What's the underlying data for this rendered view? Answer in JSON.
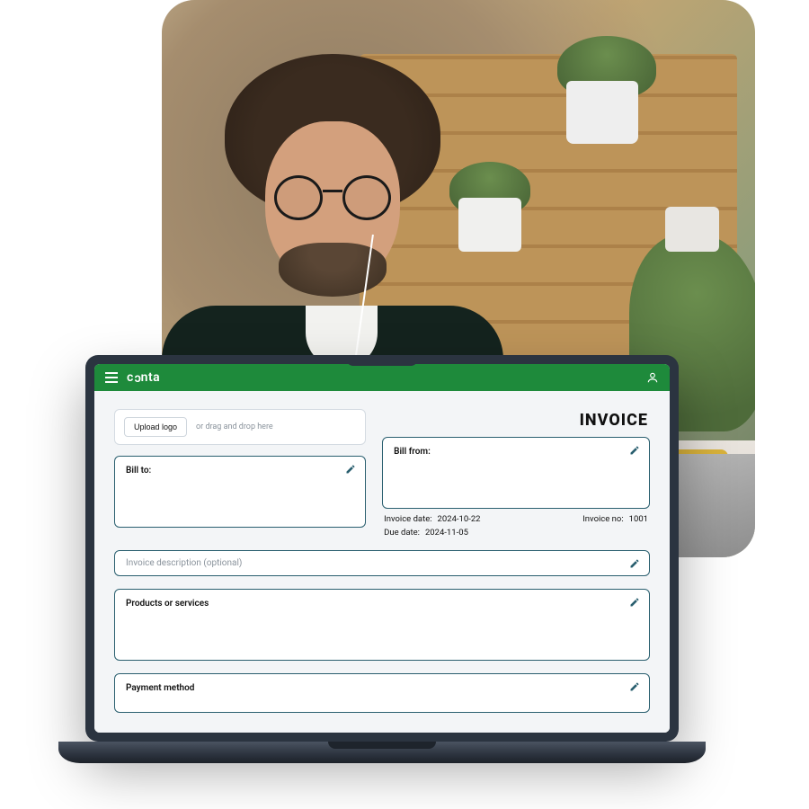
{
  "brand": {
    "name": "conta"
  },
  "header": {
    "menu_icon": "menu-icon",
    "user_icon": "user-icon"
  },
  "invoice": {
    "title": "INVOICE",
    "upload_button": "Upload logo",
    "upload_hint": "or drag and drop here",
    "bill_to_label": "Bill to:",
    "bill_from_label": "Bill from:",
    "invoice_date_label": "Invoice date:",
    "invoice_date_value": "2024-10-22",
    "due_date_label": "Due date:",
    "due_date_value": "2024-11-05",
    "invoice_no_label": "Invoice no:",
    "invoice_no_value": "1001",
    "description_placeholder": "Invoice description (optional)",
    "products_label": "Products or services",
    "payment_label": "Payment method"
  },
  "colors": {
    "brand_green": "#1e8a3b",
    "card_border": "#2a5f6f"
  }
}
